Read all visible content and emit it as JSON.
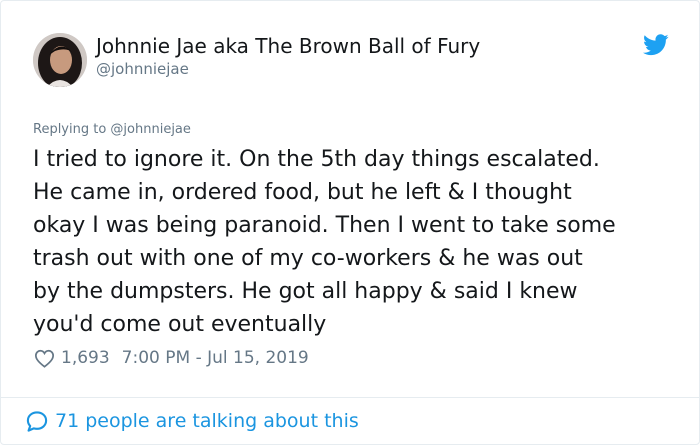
{
  "user": {
    "display_name": "Johnnie Jae aka The Brown Ball of Fury",
    "handle": "@johnniejae"
  },
  "tweet": {
    "replying_to": "Replying to @johnniejae",
    "lines": [
      "I tried to ignore it. On the 5th day things escalated.",
      "He came in, ordered food, but he left & I thought",
      "okay I was being paranoid. Then I went to take some",
      "trash out with one of my co-workers & he was out",
      "by the dumpsters. He got all happy & said I knew",
      "you'd come out eventually"
    ],
    "like_count": "1,693",
    "timestamp": "7:00 PM - Jul 15, 2019"
  },
  "footer": {
    "talking_text": "71 people are talking about this"
  },
  "icons": {
    "brand": "twitter-bird-icon",
    "like": "heart-icon",
    "reply": "speech-bubble-icon"
  },
  "colors": {
    "brand_blue": "#1da1f2",
    "link_blue": "#1b95e0",
    "secondary_text": "#657786",
    "primary_text": "#14171a",
    "border": "#e6ecf0"
  }
}
